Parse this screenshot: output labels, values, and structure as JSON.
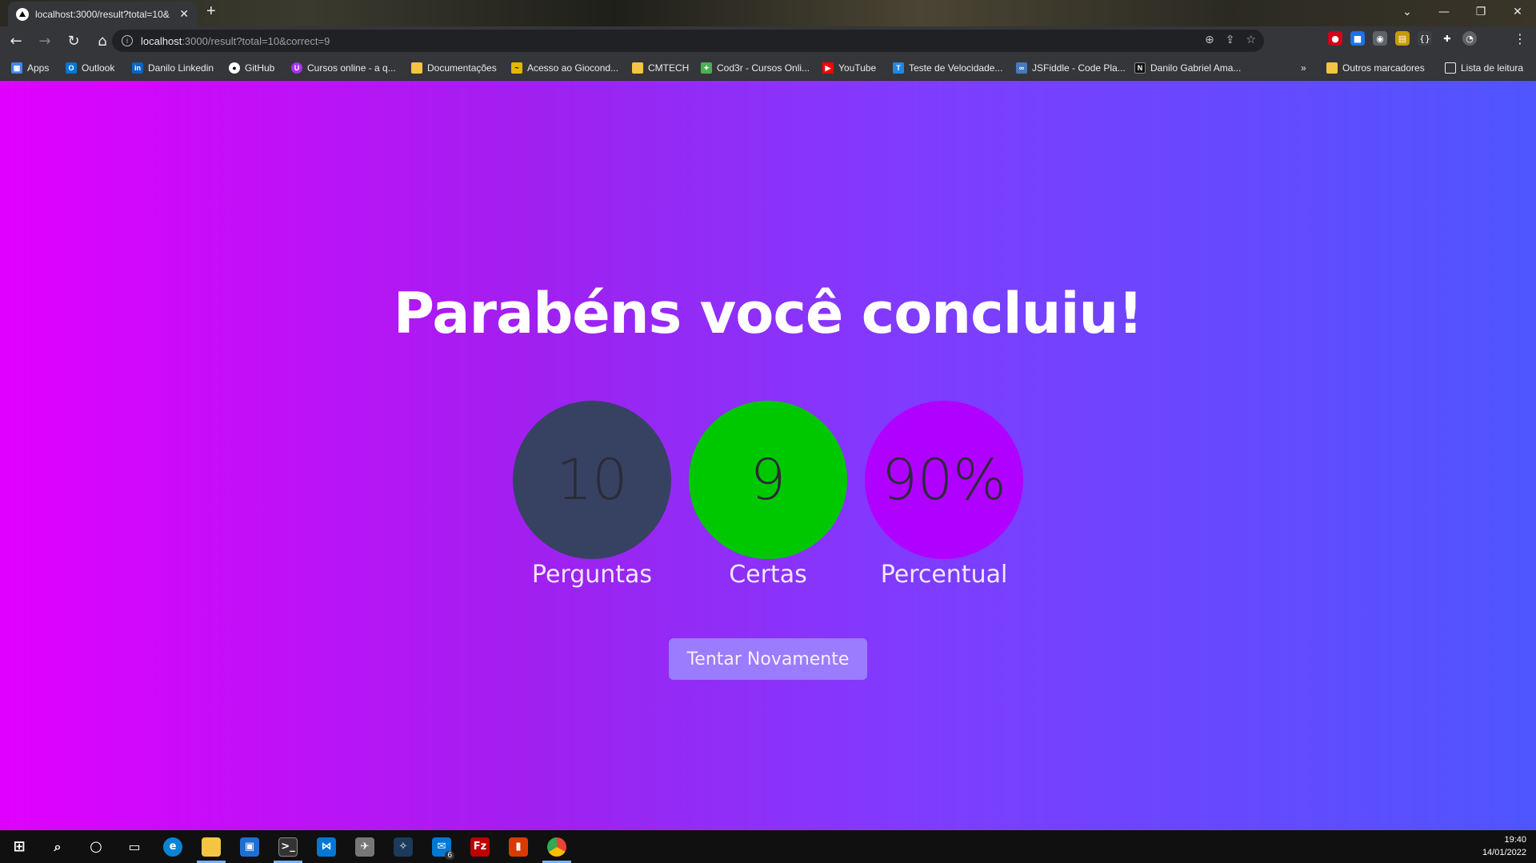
{
  "browser": {
    "tab_title": "localhost:3000/result?total=10&",
    "tab_close": "✕",
    "new_tab": "+",
    "window": {
      "minimize": "—",
      "restore": "❐",
      "close": "✕"
    },
    "url_host": "localhost",
    "url_rest": ":3000/result?total=10&correct=9",
    "bookmarks": [
      {
        "label": "Apps",
        "icon": "apps-grid-icon",
        "color": "#4285f4"
      },
      {
        "label": "Outlook",
        "icon": "outlook-icon",
        "color": "#0078d4"
      },
      {
        "label": "Danilo Linkedin",
        "icon": "linkedin-icon",
        "color": "#0a66c2"
      },
      {
        "label": "GitHub",
        "icon": "github-icon",
        "color": "#ffffff"
      },
      {
        "label": "Cursos online - a q...",
        "icon": "udemy-icon",
        "color": "#a435f0"
      },
      {
        "label": "Documentações",
        "icon": "folder-icon",
        "color": "#f4c542"
      },
      {
        "label": "Acesso ao Giocond...",
        "icon": "giocondo-icon",
        "color": "#e3b800"
      },
      {
        "label": "CMTECH",
        "icon": "folder-icon",
        "color": "#f4c542"
      },
      {
        "label": "Cod3r - Cursos Onli...",
        "icon": "cod3r-icon",
        "color": "#4caf50"
      },
      {
        "label": "YouTube",
        "icon": "youtube-icon",
        "color": "#ff0000"
      },
      {
        "label": "Teste de Velocidade...",
        "icon": "speedtest-icon",
        "color": "#1e88e5"
      },
      {
        "label": "JSFiddle - Code Pla...",
        "icon": "jsfiddle-icon",
        "color": "#4679bd"
      },
      {
        "label": "Danilo Gabriel Ama...",
        "icon": "notion-icon",
        "color": "#111111"
      }
    ],
    "bookmarks_more": "»",
    "other_bookmarks": "Outros marcadores",
    "reading_list": "Lista de leitura"
  },
  "result": {
    "title": "Parabéns você concluiu!",
    "stats": [
      {
        "value": "10",
        "label": "Perguntas",
        "color": "#374262"
      },
      {
        "value": "9",
        "label": "Certas",
        "color": "#00c800"
      },
      {
        "value": "90%",
        "label": "Percentual",
        "color": "#b000ff"
      }
    ],
    "retry_label": "Tentar Novamente"
  },
  "taskbar": {
    "time": "19:40",
    "date": "14/01/2022",
    "mail_badge": "6"
  }
}
